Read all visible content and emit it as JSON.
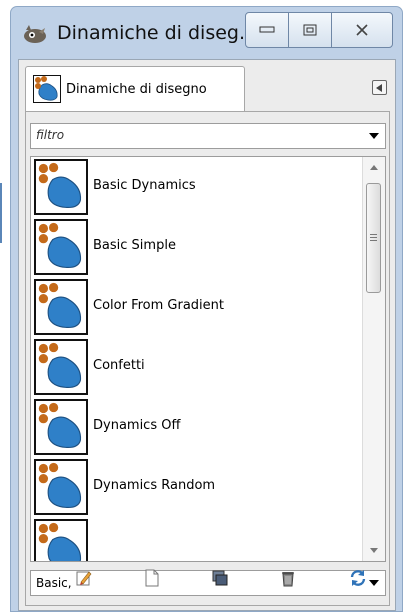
{
  "window": {
    "title": "Dinamiche di diseg...",
    "controls": {
      "minimize": "minimize-icon",
      "maximize": "maximize-icon",
      "close": "close-icon"
    }
  },
  "dock": {
    "tab_label": "Dinamiche di disegno",
    "tab_icon": "dynamics-icon",
    "tab_menu_icon": "tab-menu-icon"
  },
  "filter": {
    "placeholder": "filtro"
  },
  "dynamics_list": {
    "items": [
      {
        "label": "Basic Dynamics"
      },
      {
        "label": "Basic Simple"
      },
      {
        "label": "Color From Gradient"
      },
      {
        "label": "Confetti"
      },
      {
        "label": "Dynamics Off"
      },
      {
        "label": "Dynamics Random"
      }
    ]
  },
  "tag_filter": {
    "value": "Basic,"
  },
  "actions": [
    {
      "icon": "edit-icon"
    },
    {
      "icon": "new-document-icon"
    },
    {
      "icon": "duplicate-icon"
    },
    {
      "icon": "trash-icon"
    },
    {
      "icon": "refresh-icon"
    }
  ],
  "colors": {
    "accent_blue": "#2f80c8",
    "dot_orange": "#c46a1a",
    "frame": "#bfd1e7"
  }
}
